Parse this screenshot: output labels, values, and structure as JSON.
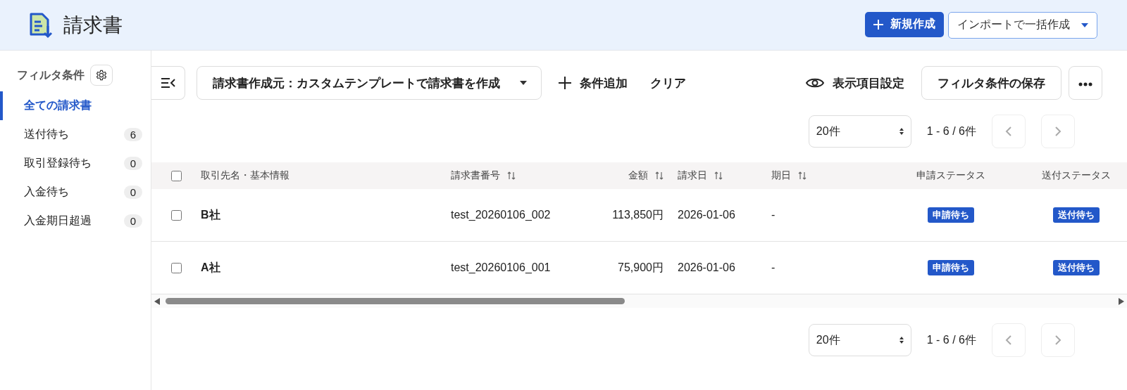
{
  "header": {
    "title": "請求書",
    "new_button": "新規作成",
    "import_button": "インポートで一括作成"
  },
  "sidebar": {
    "title": "フィルタ条件",
    "items": [
      {
        "label": "全ての請求書",
        "selected": true
      },
      {
        "label": "送付待ち",
        "count": "6",
        "selected": false
      },
      {
        "label": "取引登録待ち",
        "count": "0",
        "selected": false
      },
      {
        "label": "入金待ち",
        "count": "0",
        "selected": false
      },
      {
        "label": "入金期日超過",
        "count": "0",
        "selected": false
      }
    ]
  },
  "toolbar": {
    "filter_chip": "請求書作成元：カスタムテンプレートで請求書を作成",
    "add_condition": "条件追加",
    "clear": "クリア",
    "display_settings": "表示項目設定",
    "save_filter": "フィルタ条件の保存"
  },
  "pagination_top": {
    "page_size": "20件",
    "range": "1 - 6 / 6件",
    "prev_disabled": true,
    "next_disabled": true
  },
  "table": {
    "select_all_checked": false,
    "columns": [
      {
        "label": "取引先名・基本情報",
        "sortable": false
      },
      {
        "label": "請求書番号",
        "sortable": true
      },
      {
        "label": "金額",
        "sortable": true
      },
      {
        "label": "請求日",
        "sortable": true
      },
      {
        "label": "期日",
        "sortable": true
      },
      {
        "label": "申請ステータス",
        "sortable": false
      },
      {
        "label": "送付ステータス",
        "sortable": false
      }
    ],
    "rows": [
      {
        "checked": false,
        "client": "B社",
        "number": "test_20260106_002",
        "amount": "113,850円",
        "date": "2026-01-06",
        "due": "-",
        "apply_status": "申請待ち",
        "send_status": "送付待ち"
      },
      {
        "checked": false,
        "client": "A社",
        "number": "test_20260106_001",
        "amount": "75,900円",
        "date": "2026-01-06",
        "due": "-",
        "apply_status": "申請待ち",
        "send_status": "送付待ち"
      }
    ]
  },
  "pagination_bottom": {
    "page_size": "20件",
    "range": "1 - 6 / 6件",
    "prev_disabled": true,
    "next_disabled": true
  }
}
